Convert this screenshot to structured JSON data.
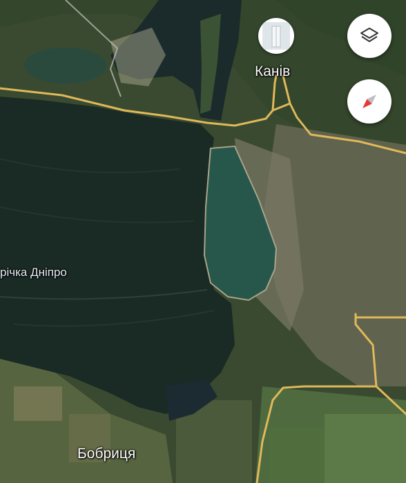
{
  "map": {
    "labels": {
      "kaniv": "Канів",
      "river": "річка Дніпро",
      "bobrytsia": "Бобриця"
    }
  },
  "controls": {
    "layers_icon": "layers-icon",
    "compass_icon": "compass-icon"
  },
  "colors": {
    "road": "#e0b95a",
    "water": "#1a2a24",
    "reservoir": "#27574a",
    "compass_red": "#e53935"
  }
}
